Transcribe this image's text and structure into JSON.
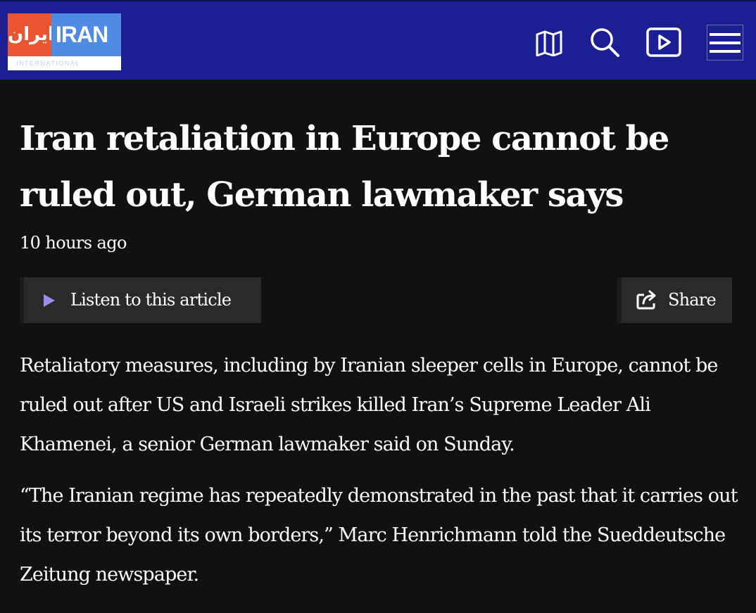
{
  "header": {
    "logo_farsi": "ایران",
    "logo_latin": "IRAN",
    "logo_sub": "INTERNATIONAL",
    "icons": [
      "map-icon",
      "search-icon",
      "video-icon",
      "menu-icon"
    ],
    "background_color": "#1c1f94"
  },
  "article": {
    "headline": "Iran retaliation in Europe cannot be ruled out, German lawmaker says",
    "timestamp": "10 hours ago",
    "listen_label": "Listen to this article",
    "share_label": "Share",
    "paragraphs": [
      "Retaliatory measures, including by Iranian sleeper cells in Europe, cannot be ruled out after US and Israeli strikes killed Iran’s Supreme Leader Ali Khamenei, a senior German lawmaker said on Sunday.",
      "“The Iranian regime has repeatedly demonstrated in the past that it carries out its terror beyond its own borders,” Marc Henrichmann told the Sueddeutsche Zeitung newspaper."
    ]
  },
  "colors": {
    "page_background": "#111111",
    "button_background": "#2a2a2a",
    "play_accent": "#9b8cf0",
    "logo_orange": "#e85530",
    "logo_blue": "#4f8be5"
  }
}
